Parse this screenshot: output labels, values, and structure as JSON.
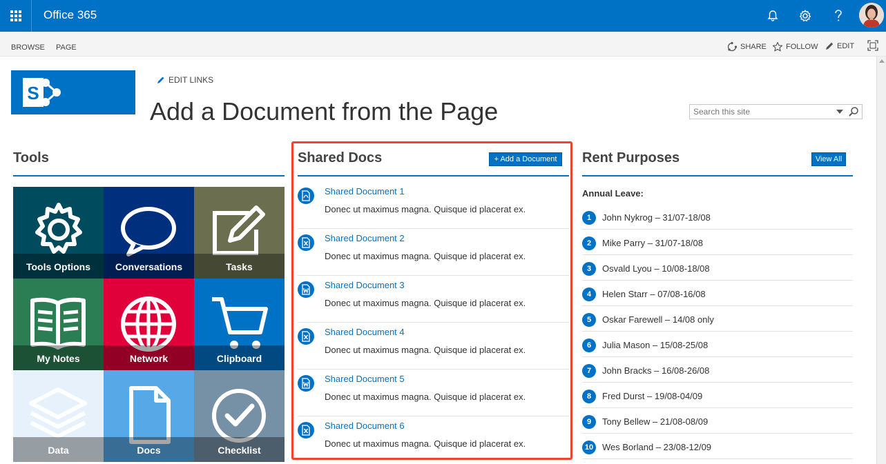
{
  "suite": {
    "title": "Office 365"
  },
  "ribbon": {
    "tabs": [
      "BROWSE",
      "PAGE"
    ],
    "share": "SHARE",
    "follow": "FOLLOW",
    "edit": "EDIT"
  },
  "header": {
    "edit_links": "EDIT LINKS",
    "page_title": "Add a Document from the Page",
    "search_placeholder": "Search this site"
  },
  "tools": {
    "heading": "Tools",
    "tiles": [
      {
        "label": "Tools Options",
        "icon": "gear-icon",
        "color": "#004b5d"
      },
      {
        "label": "Conversations",
        "icon": "speech-bubble-icon",
        "color": "#002f7d"
      },
      {
        "label": "Tasks",
        "icon": "edit-note-icon",
        "color": "#6b6f4f"
      },
      {
        "label": "My Notes",
        "icon": "book-icon",
        "color": "#2b7d53"
      },
      {
        "label": "Network",
        "icon": "globe-icon",
        "color": "#e0003a"
      },
      {
        "label": "Clipboard",
        "icon": "cart-icon",
        "color": "#0072c6"
      },
      {
        "label": "Data",
        "icon": "layers-icon",
        "color": "#e6f1fb"
      },
      {
        "label": "Docs",
        "icon": "document-icon",
        "color": "#56a8e6"
      },
      {
        "label": "Checklist",
        "icon": "checkmark-circle-icon",
        "color": "#7690a6"
      }
    ]
  },
  "shared_docs": {
    "heading": "Shared Docs",
    "add_button": "+ Add a Document",
    "items": [
      {
        "title": "Shared Document 1",
        "desc": "Donec ut maximus magna. Quisque id placerat ex.",
        "type": "pdf-icon"
      },
      {
        "title": "Shared Document 2",
        "desc": "Donec ut maximus magna. Quisque id placerat ex.",
        "type": "excel-icon"
      },
      {
        "title": "Shared Document 3",
        "desc": "Donec ut maximus magna. Quisque id placerat ex.",
        "type": "word-icon"
      },
      {
        "title": "Shared Document 4",
        "desc": "Donec ut maximus magna. Quisque id placerat ex.",
        "type": "excel-icon"
      },
      {
        "title": "Shared Document 5",
        "desc": "Donec ut maximus magna. Quisque id placerat ex.",
        "type": "word-icon"
      },
      {
        "title": "Shared Document 6",
        "desc": "Donec ut maximus magna. Quisque id placerat ex.",
        "type": "excel-icon"
      }
    ]
  },
  "rent": {
    "heading": "Rent Purposes",
    "view_all": "View All",
    "subheading": "Annual Leave:",
    "items": [
      {
        "num": "1",
        "text": "John Nykrog – 31/07-18/08"
      },
      {
        "num": "2",
        "text": "Mike Parry – 31/07-18/08"
      },
      {
        "num": "3",
        "text": "Osvald Lyou – 10/08-18/08"
      },
      {
        "num": "4",
        "text": "Helen Starr – 07/08-16/08"
      },
      {
        "num": "5",
        "text": "Oskar Farewell – 14/08 only"
      },
      {
        "num": "6",
        "text": "Julia Mason – 15/08-25/08"
      },
      {
        "num": "7",
        "text": "John Bracks – 16/08-26/08"
      },
      {
        "num": "8",
        "text": "Fred Durst – 19/08-04/09"
      },
      {
        "num": "9",
        "text": "Tony Bellew – 21/08-08/09"
      },
      {
        "num": "10",
        "text": "Wes Borland – 23/08-12/09"
      }
    ]
  },
  "colors": {
    "brand": "#0072c6",
    "highlight": "#f0432f"
  }
}
